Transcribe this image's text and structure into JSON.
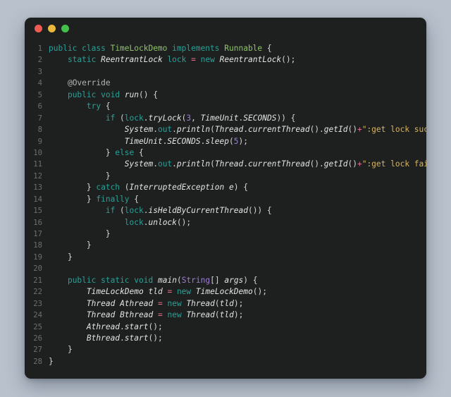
{
  "window": {
    "background_color": "#1e1f1f",
    "page_background_color": "#b9c1cd",
    "traffic_lights": [
      {
        "name": "close",
        "color": "#ef5b52"
      },
      {
        "name": "minimize",
        "color": "#e9b83c"
      },
      {
        "name": "maximize",
        "color": "#42c14a"
      }
    ]
  },
  "theme": {
    "keyword_color": "#2aa198",
    "type_color": "#8fc46b",
    "identifier_color": "#e4e4e4",
    "number_color": "#9d7cd8",
    "string_color": "#d8b45e",
    "operator_color": "#e0708a",
    "line_number_color": "#6c6f70",
    "plain_color": "#d6d6d6"
  },
  "editor": {
    "language": "Java",
    "line_numbers": [
      "1",
      "2",
      "3",
      "4",
      "5",
      "6",
      "7",
      "8",
      "9",
      "10",
      "11",
      "12",
      "13",
      "14",
      "15",
      "16",
      "17",
      "18",
      "19",
      "20",
      "21",
      "22",
      "23",
      "24",
      "25",
      "26",
      "27",
      "28"
    ],
    "code_lines": [
      "public class TimeLockDemo implements Runnable {",
      "    static ReentrantLock lock = new ReentrantLock();",
      "",
      "    @Override",
      "    public void run() {",
      "        try {",
      "            if (lock.tryLock(3, TimeUnit.SECONDS)) {",
      "                System.out.println(Thread.currentThread().getId()+\":get lock success\");",
      "                TimeUnit.SECONDS.sleep(5);",
      "            } else {",
      "                System.out.println(Thread.currentThread().getId()+\":get lock failed\");",
      "            }",
      "        } catch (InterruptedException e) {",
      "        } finally {",
      "            if (lock.isHeldByCurrentThread()) {",
      "                lock.unlock();",
      "            }",
      "        }",
      "    }",
      "",
      "    public static void main(String[] args) {",
      "        TimeLockDemo tld = new TimeLockDemo();",
      "        Thread Athread = new Thread(tld);",
      "        Thread Bthread = new Thread(tld);",
      "        Athread.start();",
      "        Bthread.start();",
      "    }",
      "}"
    ],
    "tokens": [
      [
        {
          "t": "public ",
          "c": "kw"
        },
        {
          "t": "class ",
          "c": "kw"
        },
        {
          "t": "TimeLockDemo",
          "c": "typ"
        },
        {
          "t": " ",
          "c": "pln"
        },
        {
          "t": "implements",
          "c": "kw"
        },
        {
          "t": " ",
          "c": "pln"
        },
        {
          "t": "Runnable",
          "c": "typ"
        },
        {
          "t": " {",
          "c": "pln"
        }
      ],
      [
        {
          "t": "    ",
          "c": "pln"
        },
        {
          "t": "static",
          "c": "kw"
        },
        {
          "t": " ",
          "c": "pln"
        },
        {
          "t": "ReentrantLock",
          "c": "id"
        },
        {
          "t": " ",
          "c": "pln"
        },
        {
          "t": "lock",
          "c": "fld"
        },
        {
          "t": " ",
          "c": "pln"
        },
        {
          "t": "=",
          "c": "op"
        },
        {
          "t": " ",
          "c": "pln"
        },
        {
          "t": "new",
          "c": "kw"
        },
        {
          "t": " ",
          "c": "pln"
        },
        {
          "t": "ReentrantLock",
          "c": "id"
        },
        {
          "t": "();",
          "c": "pln"
        }
      ],
      [
        {
          "t": "",
          "c": "pln"
        }
      ],
      [
        {
          "t": "    ",
          "c": "pln"
        },
        {
          "t": "@Override",
          "c": "ann"
        }
      ],
      [
        {
          "t": "    ",
          "c": "pln"
        },
        {
          "t": "public",
          "c": "kw"
        },
        {
          "t": " ",
          "c": "pln"
        },
        {
          "t": "void",
          "c": "kw"
        },
        {
          "t": " ",
          "c": "pln"
        },
        {
          "t": "run",
          "c": "id"
        },
        {
          "t": "() {",
          "c": "pln"
        }
      ],
      [
        {
          "t": "        ",
          "c": "pln"
        },
        {
          "t": "try",
          "c": "kw"
        },
        {
          "t": " {",
          "c": "pln"
        }
      ],
      [
        {
          "t": "            ",
          "c": "pln"
        },
        {
          "t": "if",
          "c": "kw"
        },
        {
          "t": " (",
          "c": "pln"
        },
        {
          "t": "lock",
          "c": "fld"
        },
        {
          "t": ".",
          "c": "pln"
        },
        {
          "t": "tryLock",
          "c": "id"
        },
        {
          "t": "(",
          "c": "pln"
        },
        {
          "t": "3",
          "c": "num"
        },
        {
          "t": ", ",
          "c": "pln"
        },
        {
          "t": "TimeUnit",
          "c": "id"
        },
        {
          "t": ".",
          "c": "pln"
        },
        {
          "t": "SECONDS",
          "c": "id"
        },
        {
          "t": ")) {",
          "c": "pln"
        }
      ],
      [
        {
          "t": "                ",
          "c": "pln"
        },
        {
          "t": "System",
          "c": "id"
        },
        {
          "t": ".",
          "c": "pln"
        },
        {
          "t": "out",
          "c": "fld"
        },
        {
          "t": ".",
          "c": "pln"
        },
        {
          "t": "println",
          "c": "id"
        },
        {
          "t": "(",
          "c": "pln"
        },
        {
          "t": "Thread",
          "c": "id"
        },
        {
          "t": ".",
          "c": "pln"
        },
        {
          "t": "currentThread",
          "c": "id"
        },
        {
          "t": "().",
          "c": "pln"
        },
        {
          "t": "getId",
          "c": "id"
        },
        {
          "t": "()",
          "c": "pln"
        },
        {
          "t": "+",
          "c": "op"
        },
        {
          "t": "\":get lock success\"",
          "c": "str"
        },
        {
          "t": ");",
          "c": "pln"
        }
      ],
      [
        {
          "t": "                ",
          "c": "pln"
        },
        {
          "t": "TimeUnit",
          "c": "id"
        },
        {
          "t": ".",
          "c": "pln"
        },
        {
          "t": "SECONDS",
          "c": "id"
        },
        {
          "t": ".",
          "c": "pln"
        },
        {
          "t": "sleep",
          "c": "id"
        },
        {
          "t": "(",
          "c": "pln"
        },
        {
          "t": "5",
          "c": "num"
        },
        {
          "t": ");",
          "c": "pln"
        }
      ],
      [
        {
          "t": "            } ",
          "c": "pln"
        },
        {
          "t": "else",
          "c": "kw"
        },
        {
          "t": " {",
          "c": "pln"
        }
      ],
      [
        {
          "t": "                ",
          "c": "pln"
        },
        {
          "t": "System",
          "c": "id"
        },
        {
          "t": ".",
          "c": "pln"
        },
        {
          "t": "out",
          "c": "fld"
        },
        {
          "t": ".",
          "c": "pln"
        },
        {
          "t": "println",
          "c": "id"
        },
        {
          "t": "(",
          "c": "pln"
        },
        {
          "t": "Thread",
          "c": "id"
        },
        {
          "t": ".",
          "c": "pln"
        },
        {
          "t": "currentThread",
          "c": "id"
        },
        {
          "t": "().",
          "c": "pln"
        },
        {
          "t": "getId",
          "c": "id"
        },
        {
          "t": "()",
          "c": "pln"
        },
        {
          "t": "+",
          "c": "op"
        },
        {
          "t": "\":get lock failed\"",
          "c": "str"
        },
        {
          "t": ");",
          "c": "pln"
        }
      ],
      [
        {
          "t": "            }",
          "c": "pln"
        }
      ],
      [
        {
          "t": "        } ",
          "c": "pln"
        },
        {
          "t": "catch",
          "c": "kw"
        },
        {
          "t": " (",
          "c": "pln"
        },
        {
          "t": "InterruptedException",
          "c": "id"
        },
        {
          "t": " ",
          "c": "pln"
        },
        {
          "t": "e",
          "c": "id"
        },
        {
          "t": ") {",
          "c": "pln"
        }
      ],
      [
        {
          "t": "        } ",
          "c": "pln"
        },
        {
          "t": "finally",
          "c": "kw"
        },
        {
          "t": " {",
          "c": "pln"
        }
      ],
      [
        {
          "t": "            ",
          "c": "pln"
        },
        {
          "t": "if",
          "c": "kw"
        },
        {
          "t": " (",
          "c": "pln"
        },
        {
          "t": "lock",
          "c": "fld"
        },
        {
          "t": ".",
          "c": "pln"
        },
        {
          "t": "isHeldByCurrentThread",
          "c": "id"
        },
        {
          "t": "()) {",
          "c": "pln"
        }
      ],
      [
        {
          "t": "                ",
          "c": "pln"
        },
        {
          "t": "lock",
          "c": "fld"
        },
        {
          "t": ".",
          "c": "pln"
        },
        {
          "t": "unlock",
          "c": "id"
        },
        {
          "t": "();",
          "c": "pln"
        }
      ],
      [
        {
          "t": "            }",
          "c": "pln"
        }
      ],
      [
        {
          "t": "        }",
          "c": "pln"
        }
      ],
      [
        {
          "t": "    }",
          "c": "pln"
        }
      ],
      [
        {
          "t": "",
          "c": "pln"
        }
      ],
      [
        {
          "t": "    ",
          "c": "pln"
        },
        {
          "t": "public",
          "c": "kw"
        },
        {
          "t": " ",
          "c": "pln"
        },
        {
          "t": "static",
          "c": "kw"
        },
        {
          "t": " ",
          "c": "pln"
        },
        {
          "t": "void",
          "c": "kw"
        },
        {
          "t": " ",
          "c": "pln"
        },
        {
          "t": "main",
          "c": "id"
        },
        {
          "t": "(",
          "c": "pln"
        },
        {
          "t": "String",
          "c": "cls"
        },
        {
          "t": "[] ",
          "c": "pln"
        },
        {
          "t": "args",
          "c": "id"
        },
        {
          "t": ") {",
          "c": "pln"
        }
      ],
      [
        {
          "t": "        ",
          "c": "pln"
        },
        {
          "t": "TimeLockDemo",
          "c": "id"
        },
        {
          "t": " ",
          "c": "pln"
        },
        {
          "t": "tld",
          "c": "id"
        },
        {
          "t": " ",
          "c": "pln"
        },
        {
          "t": "=",
          "c": "op"
        },
        {
          "t": " ",
          "c": "pln"
        },
        {
          "t": "new",
          "c": "kw"
        },
        {
          "t": " ",
          "c": "pln"
        },
        {
          "t": "TimeLockDemo",
          "c": "id"
        },
        {
          "t": "();",
          "c": "pln"
        }
      ],
      [
        {
          "t": "        ",
          "c": "pln"
        },
        {
          "t": "Thread",
          "c": "id"
        },
        {
          "t": " ",
          "c": "pln"
        },
        {
          "t": "Athread",
          "c": "id"
        },
        {
          "t": " ",
          "c": "pln"
        },
        {
          "t": "=",
          "c": "op"
        },
        {
          "t": " ",
          "c": "pln"
        },
        {
          "t": "new",
          "c": "kw"
        },
        {
          "t": " ",
          "c": "pln"
        },
        {
          "t": "Thread",
          "c": "id"
        },
        {
          "t": "(",
          "c": "pln"
        },
        {
          "t": "tld",
          "c": "id"
        },
        {
          "t": ");",
          "c": "pln"
        }
      ],
      [
        {
          "t": "        ",
          "c": "pln"
        },
        {
          "t": "Thread",
          "c": "id"
        },
        {
          "t": " ",
          "c": "pln"
        },
        {
          "t": "Bthread",
          "c": "id"
        },
        {
          "t": " ",
          "c": "pln"
        },
        {
          "t": "=",
          "c": "op"
        },
        {
          "t": " ",
          "c": "pln"
        },
        {
          "t": "new",
          "c": "kw"
        },
        {
          "t": " ",
          "c": "pln"
        },
        {
          "t": "Thread",
          "c": "id"
        },
        {
          "t": "(",
          "c": "pln"
        },
        {
          "t": "tld",
          "c": "id"
        },
        {
          "t": ");",
          "c": "pln"
        }
      ],
      [
        {
          "t": "        ",
          "c": "pln"
        },
        {
          "t": "Athread",
          "c": "id"
        },
        {
          "t": ".",
          "c": "pln"
        },
        {
          "t": "start",
          "c": "id"
        },
        {
          "t": "();",
          "c": "pln"
        }
      ],
      [
        {
          "t": "        ",
          "c": "pln"
        },
        {
          "t": "Bthread",
          "c": "id"
        },
        {
          "t": ".",
          "c": "pln"
        },
        {
          "t": "start",
          "c": "id"
        },
        {
          "t": "();",
          "c": "pln"
        }
      ],
      [
        {
          "t": "    }",
          "c": "pln"
        }
      ],
      [
        {
          "t": "}",
          "c": "pln"
        }
      ]
    ]
  }
}
